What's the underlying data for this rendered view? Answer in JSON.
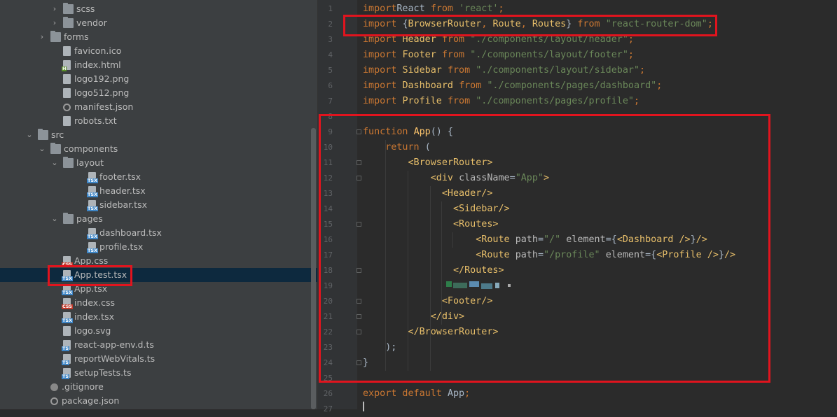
{
  "tree": {
    "items": [
      {
        "label": "scss",
        "depth": 5,
        "kind": "folder",
        "arrow": "›"
      },
      {
        "label": "vendor",
        "depth": 5,
        "kind": "folder",
        "arrow": "›"
      },
      {
        "label": "forms",
        "depth": 4,
        "kind": "folder",
        "arrow": "›"
      },
      {
        "label": "favicon.ico",
        "depth": 5,
        "kind": "file",
        "badge": ""
      },
      {
        "label": "index.html",
        "depth": 5,
        "kind": "file",
        "badge": "H"
      },
      {
        "label": "logo192.png",
        "depth": 5,
        "kind": "file",
        "badge": ""
      },
      {
        "label": "logo512.png",
        "depth": 5,
        "kind": "file",
        "badge": ""
      },
      {
        "label": "manifest.json",
        "depth": 5,
        "kind": "gear"
      },
      {
        "label": "robots.txt",
        "depth": 5,
        "kind": "file",
        "badge": ""
      },
      {
        "label": "src",
        "depth": 3,
        "kind": "folder",
        "arrow": "⌄"
      },
      {
        "label": "components",
        "depth": 4,
        "kind": "folder",
        "arrow": "⌄"
      },
      {
        "label": "layout",
        "depth": 5,
        "kind": "folder",
        "arrow": "⌄"
      },
      {
        "label": "footer.tsx",
        "depth": 7,
        "kind": "file",
        "badge": "TSX"
      },
      {
        "label": "header.tsx",
        "depth": 7,
        "kind": "file",
        "badge": "TSX"
      },
      {
        "label": "sidebar.tsx",
        "depth": 7,
        "kind": "file",
        "badge": "TSX"
      },
      {
        "label": "pages",
        "depth": 5,
        "kind": "folder",
        "arrow": "⌄"
      },
      {
        "label": "dashboard.tsx",
        "depth": 7,
        "kind": "file",
        "badge": "TSX"
      },
      {
        "label": "profile.tsx",
        "depth": 7,
        "kind": "file",
        "badge": "TSX"
      },
      {
        "label": "App.css",
        "depth": 5,
        "kind": "file",
        "badge": "CSS"
      },
      {
        "label": "App.test.tsx",
        "depth": 5,
        "kind": "file",
        "badge": "TSX",
        "selected": true
      },
      {
        "label": "App.tsx",
        "depth": 5,
        "kind": "file",
        "badge": "TSX"
      },
      {
        "label": "index.css",
        "depth": 5,
        "kind": "file",
        "badge": "CSS"
      },
      {
        "label": "index.tsx",
        "depth": 5,
        "kind": "file",
        "badge": "TSX"
      },
      {
        "label": "logo.svg",
        "depth": 5,
        "kind": "file",
        "badge": ""
      },
      {
        "label": "react-app-env.d.ts",
        "depth": 5,
        "kind": "file",
        "badge": "TS"
      },
      {
        "label": "reportWebVitals.ts",
        "depth": 5,
        "kind": "file",
        "badge": "TS"
      },
      {
        "label": "setupTests.ts",
        "depth": 5,
        "kind": "file",
        "badge": "TS"
      },
      {
        "label": ".gitignore",
        "depth": 4,
        "kind": "git"
      },
      {
        "label": "package.json",
        "depth": 4,
        "kind": "gear"
      }
    ]
  },
  "editor": {
    "lines": [
      {
        "n": "1",
        "tokens": [
          [
            "kw",
            "import"
          ],
          [
            "",
            "React "
          ],
          [
            "kw",
            "from "
          ],
          [
            "str",
            "'react'"
          ],
          [
            "kw",
            ";"
          ]
        ]
      },
      {
        "n": "2",
        "tokens": [
          [
            "kw",
            "import "
          ],
          [
            "",
            "{"
          ],
          [
            "imp-b",
            "BrowserRouter"
          ],
          [
            "kw",
            ", "
          ],
          [
            "imp-b",
            "Route"
          ],
          [
            "kw",
            ", "
          ],
          [
            "imp-b",
            "Routes"
          ],
          [
            "",
            "} "
          ],
          [
            "kw",
            "from "
          ],
          [
            "str",
            "\"react-router-dom\""
          ],
          [
            "kw",
            ";"
          ]
        ]
      },
      {
        "n": "3",
        "tokens": [
          [
            "kw",
            "import "
          ],
          [
            "imp-b",
            "Header "
          ],
          [
            "kw",
            "from "
          ],
          [
            "str",
            "\"./components/layout/header\""
          ],
          [
            "kw",
            ";"
          ]
        ]
      },
      {
        "n": "4",
        "tokens": [
          [
            "kw",
            "import "
          ],
          [
            "imp-b",
            "Footer "
          ],
          [
            "kw",
            "from "
          ],
          [
            "str",
            "\"./components/layout/footer\""
          ],
          [
            "kw",
            ";"
          ]
        ]
      },
      {
        "n": "5",
        "tokens": [
          [
            "kw",
            "import "
          ],
          [
            "imp-b",
            "Sidebar "
          ],
          [
            "kw",
            "from "
          ],
          [
            "str",
            "\"./components/layout/sidebar\""
          ],
          [
            "kw",
            ";"
          ]
        ]
      },
      {
        "n": "6",
        "tokens": [
          [
            "kw",
            "import "
          ],
          [
            "imp-b",
            "Dashboard "
          ],
          [
            "kw",
            "from "
          ],
          [
            "str",
            "\"./components/pages/dashboard\""
          ],
          [
            "kw",
            ";"
          ]
        ]
      },
      {
        "n": "7",
        "tokens": [
          [
            "kw",
            "import "
          ],
          [
            "imp-b",
            "Profile "
          ],
          [
            "kw",
            "from "
          ],
          [
            "str",
            "\"./components/pages/profile\""
          ],
          [
            "kw",
            ";"
          ]
        ]
      },
      {
        "n": "8",
        "tokens": []
      },
      {
        "n": "9",
        "tokens": [
          [
            "kw",
            "function "
          ],
          [
            "fn",
            "App"
          ],
          [
            "",
            "() {"
          ]
        ]
      },
      {
        "n": "10",
        "tokens": [
          [
            "",
            "    "
          ],
          [
            "kw",
            "return "
          ],
          [
            "",
            "("
          ]
        ]
      },
      {
        "n": "11",
        "tokens": [
          [
            "",
            "        "
          ],
          [
            "tag",
            "<BrowserRouter>"
          ]
        ]
      },
      {
        "n": "12",
        "tokens": [
          [
            "",
            "            "
          ],
          [
            "tag",
            "<div "
          ],
          [
            "attr",
            "className"
          ],
          [
            "",
            "="
          ],
          [
            "str",
            "\"App\""
          ],
          [
            "tag",
            ">"
          ]
        ]
      },
      {
        "n": "13",
        "tokens": [
          [
            "",
            "              "
          ],
          [
            "tag",
            "<Header/>"
          ]
        ]
      },
      {
        "n": "14",
        "tokens": [
          [
            "",
            "                "
          ],
          [
            "tag",
            "<Sidebar/>"
          ]
        ]
      },
      {
        "n": "15",
        "tokens": [
          [
            "",
            "                "
          ],
          [
            "tag",
            "<Routes>"
          ]
        ]
      },
      {
        "n": "16",
        "tokens": [
          [
            "",
            "                    "
          ],
          [
            "tag",
            "<Route "
          ],
          [
            "attr",
            "path"
          ],
          [
            "",
            "="
          ],
          [
            "str",
            "\"/\" "
          ],
          [
            "attr",
            "element"
          ],
          [
            "",
            "={"
          ],
          [
            "tag",
            "<Dashboard />"
          ],
          [
            "",
            "}"
          ],
          [
            "tag",
            "/>"
          ]
        ]
      },
      {
        "n": "17",
        "tokens": [
          [
            "",
            "                    "
          ],
          [
            "tag",
            "<Route "
          ],
          [
            "attr",
            "path"
          ],
          [
            "",
            "="
          ],
          [
            "str",
            "\"/profile\" "
          ],
          [
            "attr",
            "element"
          ],
          [
            "",
            "={"
          ],
          [
            "tag",
            "<Profile />"
          ],
          [
            "",
            "}"
          ],
          [
            "tag",
            "/>"
          ]
        ]
      },
      {
        "n": "18",
        "tokens": [
          [
            "",
            "                "
          ],
          [
            "tag",
            "</Routes>"
          ]
        ]
      },
      {
        "n": "19",
        "tokens": []
      },
      {
        "n": "20",
        "tokens": [
          [
            "",
            "              "
          ],
          [
            "tag",
            "<Footer/>"
          ]
        ]
      },
      {
        "n": "21",
        "tokens": [
          [
            "",
            "            "
          ],
          [
            "tag",
            "</div>"
          ]
        ]
      },
      {
        "n": "22",
        "tokens": [
          [
            "",
            "        "
          ],
          [
            "tag",
            "</BrowserRouter>"
          ]
        ]
      },
      {
        "n": "23",
        "tokens": [
          [
            "",
            "    );"
          ]
        ]
      },
      {
        "n": "24",
        "tokens": [
          [
            "",
            "}"
          ]
        ]
      },
      {
        "n": "25",
        "tokens": []
      },
      {
        "n": "26",
        "tokens": [
          [
            "kw",
            "export default "
          ],
          [
            "",
            "App"
          ],
          [
            "kw",
            ";"
          ]
        ]
      },
      {
        "n": "27",
        "tokens": []
      }
    ]
  },
  "colors": {
    "highlight": "#e1141e",
    "selection": "#0d293e",
    "keyword": "#cc7832",
    "string": "#6a8759",
    "tag": "#e8bf6a"
  }
}
